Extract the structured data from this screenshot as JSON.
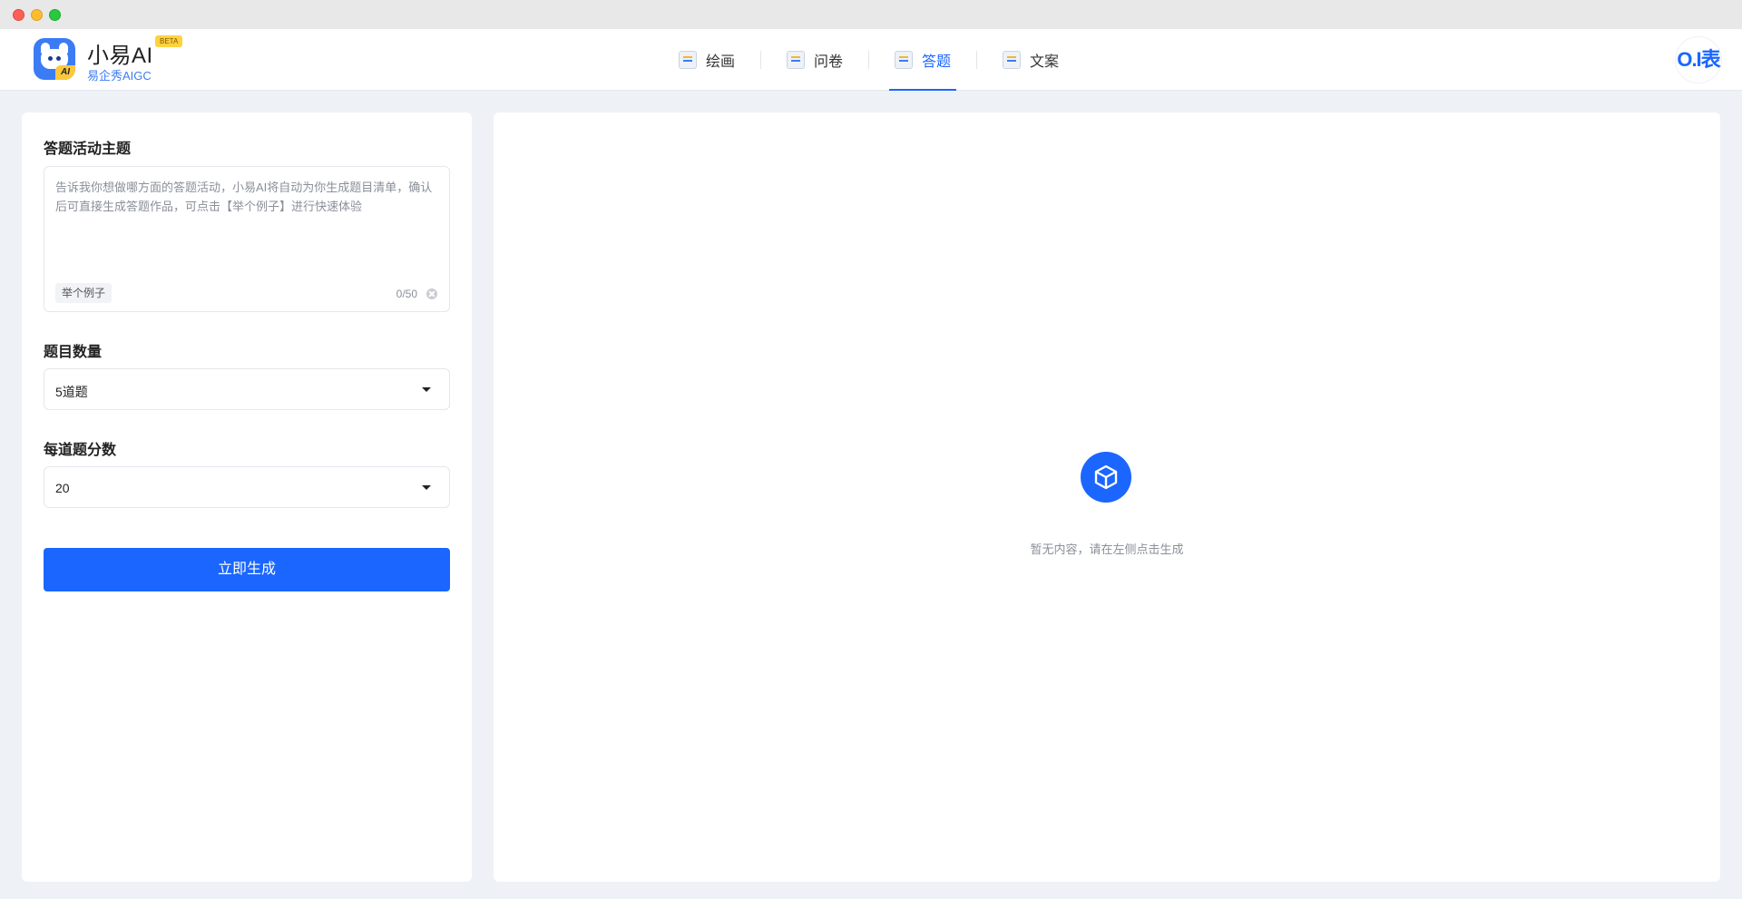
{
  "brand": {
    "name": "小易AI",
    "badge": "BETA",
    "subtitle": "易企秀AIGC",
    "logo_tag": "AI"
  },
  "nav": {
    "items": [
      {
        "label": "绘画",
        "icon": "paint-icon",
        "active": false
      },
      {
        "label": "问卷",
        "icon": "survey-icon",
        "active": false
      },
      {
        "label": "答题",
        "icon": "quiz-icon",
        "active": true
      },
      {
        "label": "文案",
        "icon": "copywriting-icon",
        "active": false
      }
    ]
  },
  "right_logo": {
    "text": "O.I表",
    "icon": "partner-logo-icon"
  },
  "form": {
    "topic": {
      "label": "答题活动主题",
      "placeholder": "告诉我你想做哪方面的答题活动，小易AI将自动为你生成题目清单，确认后可直接生成答题作品，可点击【举个例子】进行快速体验",
      "example_button": "举个例子",
      "counter": "0/50"
    },
    "question_count": {
      "label": "题目数量",
      "value": "5道题"
    },
    "score_per_question": {
      "label": "每道题分数",
      "value": "20"
    },
    "generate_button": "立即生成"
  },
  "result": {
    "empty_icon": "box-icon",
    "empty_text": "暂无内容，请在左侧点击生成"
  },
  "colors": {
    "accent": "#1a66ff",
    "background": "#eef1f5",
    "badge": "#ffd23f"
  }
}
